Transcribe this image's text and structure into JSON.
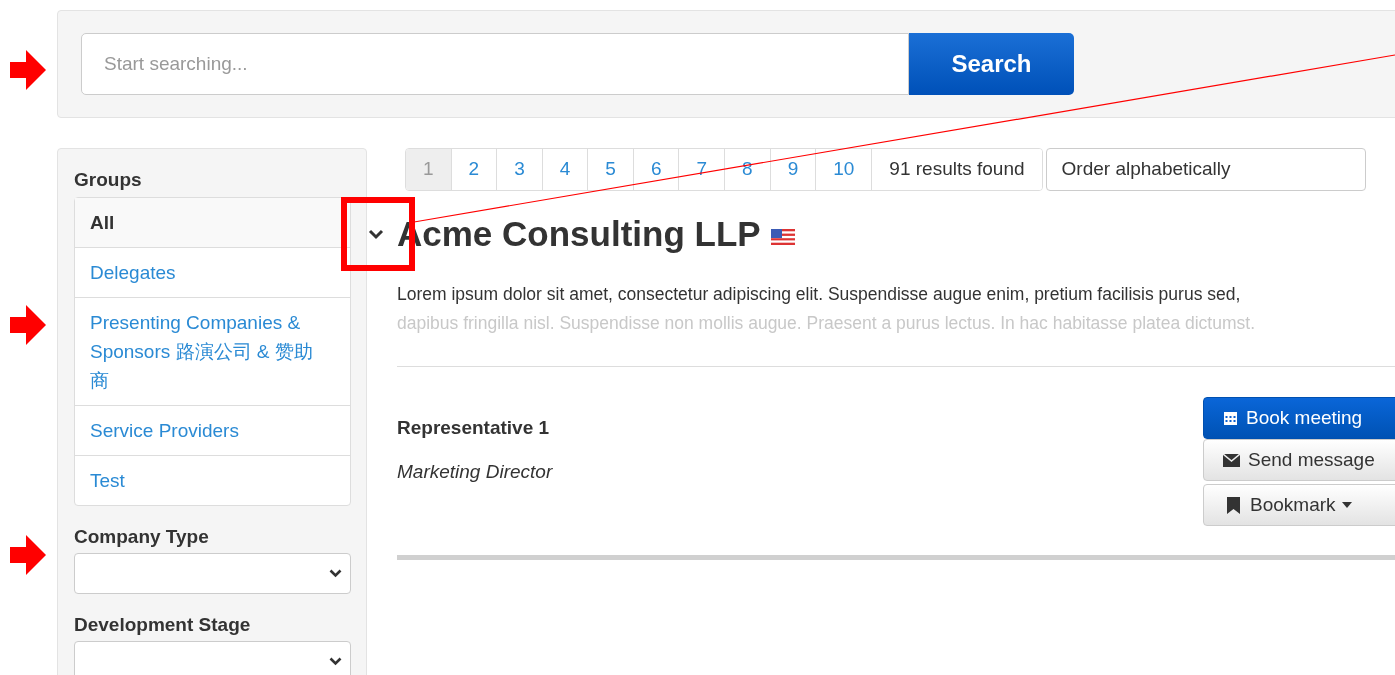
{
  "search": {
    "placeholder": "Start searching...",
    "button": "Search"
  },
  "sidebar": {
    "groups_title": "Groups",
    "groups": [
      {
        "label": "All",
        "selected": true
      },
      {
        "label": "Delegates",
        "selected": false
      },
      {
        "label": "Presenting Companies & Sponsors 路演公司 & 赞助商",
        "selected": false
      },
      {
        "label": "Service Providers",
        "selected": false
      },
      {
        "label": "Test",
        "selected": false
      }
    ],
    "filters": [
      {
        "label": "Company Type"
      },
      {
        "label": "Development Stage"
      }
    ]
  },
  "pagination": {
    "pages": [
      {
        "label": "1",
        "selected": true
      },
      {
        "label": "2",
        "selected": false
      },
      {
        "label": "3",
        "selected": false
      },
      {
        "label": "4",
        "selected": false
      },
      {
        "label": "5",
        "selected": false
      },
      {
        "label": "6",
        "selected": false
      },
      {
        "label": "7",
        "selected": false
      },
      {
        "label": "8",
        "selected": false
      },
      {
        "label": "9",
        "selected": false
      },
      {
        "label": "10",
        "selected": false
      }
    ],
    "results": "91 results found",
    "order": "Order alphabetically"
  },
  "company": {
    "name": "Acme Consulting LLP",
    "expanded": true,
    "description": [
      "Lorem ipsum dolor sit amet, consectetur adipiscing elit. Suspendisse augue enim, pretium facilisis purus sed,",
      "dapibus fringilla nisl. Suspendisse non mollis augue. Praesent a purus lectus. In hac habitasse platea dictumst."
    ],
    "representative": {
      "name": "Representative 1",
      "title": "Marketing Director"
    },
    "actions": [
      {
        "kind": "calendar",
        "label": "Book meeting",
        "primary": true
      },
      {
        "kind": "envelope",
        "label": "Send message",
        "primary": false
      },
      {
        "kind": "bookmark",
        "label": "Bookmark",
        "primary": false,
        "dropdown": true
      }
    ]
  }
}
